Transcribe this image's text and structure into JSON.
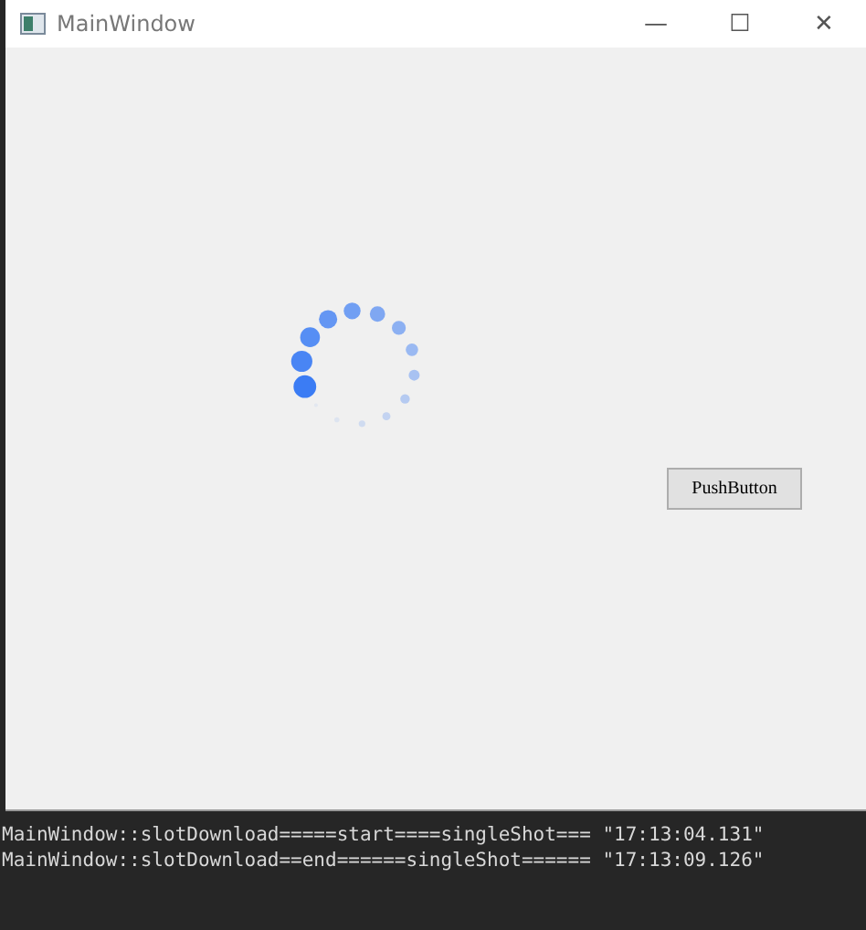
{
  "window": {
    "title": "MainWindow"
  },
  "window_controls": [
    "—",
    "☐",
    "✕"
  ],
  "push_button": {
    "label": "PushButton"
  },
  "console_lines": [
    "MainWindow::slotDownload=====start====singleShot=== \"17:13:04.131\"",
    "MainWindow::slotDownload==end======singleShot====== \"17:13:09.126\""
  ]
}
